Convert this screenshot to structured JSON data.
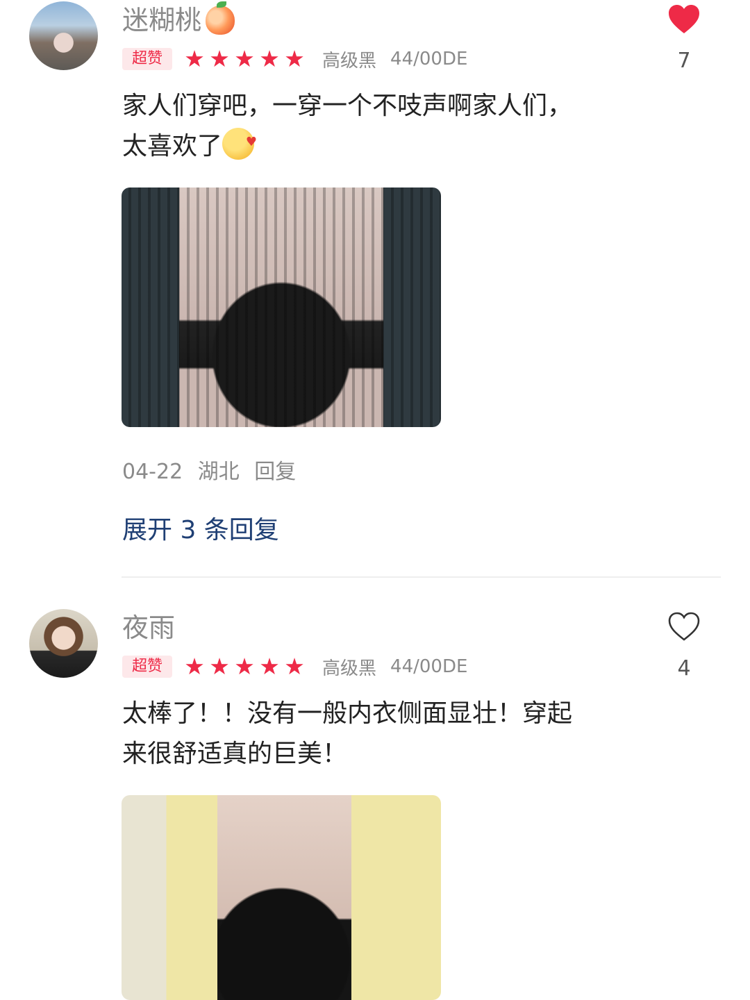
{
  "reviews": [
    {
      "username": "迷糊桃",
      "username_emoji": "peach-icon",
      "badge": "超赞",
      "stars": [
        "★",
        "★",
        "★",
        "★",
        "★"
      ],
      "spec_color": "高级黑",
      "spec_size": "44/00DE",
      "liked": true,
      "like_count": "7",
      "text": "家人们穿吧，一穿一个不吱声啊家人们，太喜欢了",
      "text_emoji": "kiss-face-icon",
      "date": "04-22",
      "location": "湖北",
      "reply_label": "回复",
      "expand_label": "展开 3 条回复"
    },
    {
      "username": "夜雨",
      "badge": "超赞",
      "stars": [
        "★",
        "★",
        "★",
        "★",
        "★"
      ],
      "spec_color": "高级黑",
      "spec_size": "44/00DE",
      "liked": false,
      "like_count": "4",
      "text": "太棒了！！没有一般内衣侧面显壮！穿起来很舒适真的巨美！"
    }
  ],
  "colors": {
    "accent": "#ee2a47",
    "badge_bg": "#fde8ea",
    "link": "#1f3f74",
    "muted": "#8a8a8a"
  }
}
